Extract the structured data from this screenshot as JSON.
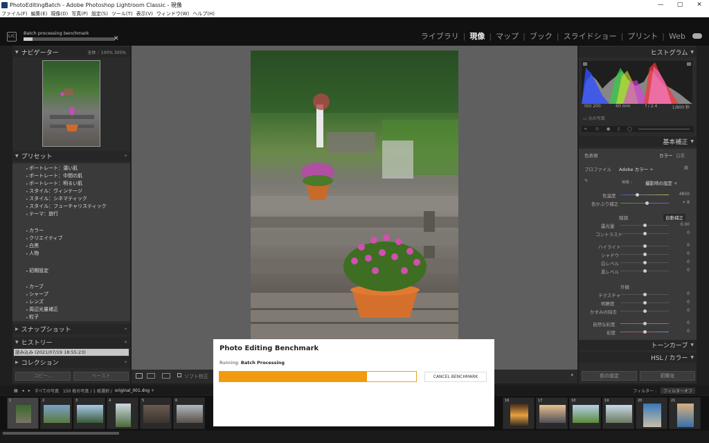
{
  "window": {
    "title": "PhotoEditingBatch - Adobe Photoshop Lightroom Classic - 現像"
  },
  "menu": [
    "ファイル(F)",
    "編集(E)",
    "現像(D)",
    "写真(P)",
    "設定(S)",
    "ツール(T)",
    "表示(V)",
    "ウィンドウ(W)",
    "ヘルプ(H)"
  ],
  "top": {
    "badge": "LrC",
    "progress_title": "Batch processing benchmark",
    "progress": 0.1,
    "modules": [
      "ライブラリ",
      "現像",
      "マップ",
      "ブック",
      "スライドショー",
      "プリント",
      "Web"
    ],
    "active_module": "現像"
  },
  "left": {
    "navigator": "ナビゲーター",
    "nav_opts": "全体 ◦ 100% 300%",
    "presets_title": "プリセット",
    "presets": [
      "ポートレート：濃い肌",
      "ポートレート：中間の肌",
      "ポートレート：明るい肌",
      "スタイル：ヴィンテージ",
      "スタイル：シネマティック",
      "スタイル：フューチャリスティック",
      "テーマ：旅行",
      "カラー",
      "クリエイティブ",
      "白黒",
      "人物",
      "初期設定",
      "カーブ",
      "シャープ",
      "レンズ",
      "周辺光量補正",
      "粒子"
    ],
    "snapshot": "スナップショット",
    "history": "ヒストリー",
    "history_entry": "読み込み (2021/07/19 18:55:23)",
    "collection": "コレクション",
    "copy": "コピー...",
    "paste": "ペースト"
  },
  "toolbar": {
    "softproof": "ソフト校正"
  },
  "right": {
    "histogram": "ヒストグラム",
    "iso": "ISO 200",
    "focal": "60 mm",
    "aperture": "f / 2.4",
    "shutter": "1/800 秒",
    "original": "元の写真",
    "basic": "基本補正",
    "treatment": "色表現",
    "color": "カラー",
    "bw": "白黒",
    "profile": "プロファイル",
    "profile_val": "Adobe カラー ÷",
    "wb": "WB :",
    "wb_val": "撮影時の設定 ÷",
    "temp": "色温度",
    "temp_val": "4850",
    "tint": "色かぶり補正",
    "tint_val": "+ 8",
    "tone": "階調",
    "auto": "自動補正",
    "exposure": "露光量",
    "exposure_val": "0.00",
    "contrast": "コントラスト",
    "highlights": "ハイライト",
    "shadows": "シャドウ",
    "whites": "白レベル",
    "blacks": "黒レベル",
    "presence": "外観",
    "texture": "テクスチャ",
    "clarity": "明瞭度",
    "dehaze": "かすみの除去",
    "vibrance": "自然な彩度",
    "saturation": "彩度",
    "zero": "0",
    "tonecurve": "トーンカーブ",
    "hsl": "HSL / カラー",
    "previous": "前の設定",
    "reset": "初期化"
  },
  "filmbar": {
    "source": "すべての写真",
    "count": "150 枚の写真 / 1 枚選択 /",
    "file": "original_001.dng ÷",
    "filter": "フィルター :",
    "filter_val": "フィルターオフ"
  },
  "filmstrip": {
    "numbers": [
      "1",
      "2",
      "3",
      "4",
      "5",
      "6",
      "16",
      "17",
      "18",
      "19",
      "20",
      "21"
    ]
  },
  "dialog": {
    "title": "Photo Editing Benchmark",
    "running_label": "Running:",
    "running_task": "Batch Processing",
    "progress": 0.75,
    "cancel": "CANCEL BENCHMARK"
  }
}
